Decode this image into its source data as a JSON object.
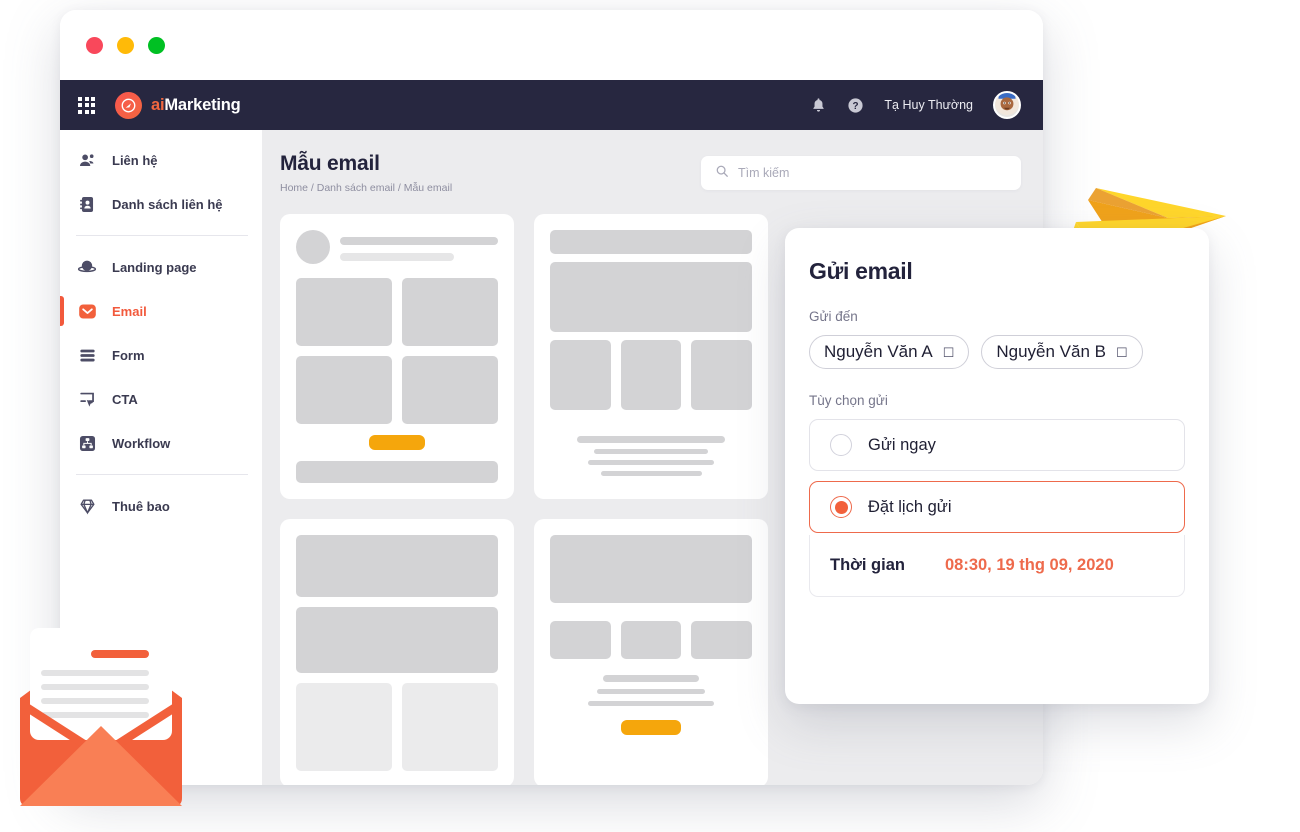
{
  "window": {
    "traffic_lights": [
      "close",
      "minimize",
      "maximize"
    ],
    "colors": {
      "close": "#F9485B",
      "minimize": "#FFBA08",
      "maximize": "#00C023"
    }
  },
  "topbar": {
    "apps_icon": "grid-apps-icon",
    "brand_prefix": "ai",
    "brand_suffix": "Marketing",
    "notifications_icon": "bell-icon",
    "help_icon": "question-circle-icon",
    "user_name": "Tạ Huy Thường",
    "avatar": "user-avatar",
    "background": "#272740"
  },
  "sidebar": {
    "items": [
      {
        "label": "Liên hệ",
        "icon": "contacts-icon",
        "active": false
      },
      {
        "label": "Danh sách liên hệ",
        "icon": "contact-book-icon",
        "active": false
      },
      {
        "label": "Landing page",
        "icon": "landing-page-icon",
        "active": false
      },
      {
        "label": "Email",
        "icon": "email-icon",
        "active": true
      },
      {
        "label": "Form",
        "icon": "form-icon",
        "active": false
      },
      {
        "label": "CTA",
        "icon": "cta-icon",
        "active": false
      },
      {
        "label": "Workflow",
        "icon": "workflow-icon",
        "active": false
      },
      {
        "label": "Thuê bao",
        "icon": "diamond-icon",
        "active": false
      }
    ],
    "active_color": "#F2593C"
  },
  "page": {
    "title": "Mẫu email",
    "breadcrumb": "Home / Danh sách email / Mẫu email",
    "search": {
      "placeholder": "Tìm kiếm",
      "value": "",
      "icon": "search-icon"
    }
  },
  "templates": {
    "cards": [
      {
        "name": "template-card-1",
        "layout": "avatar-header-2x2-grid-button"
      },
      {
        "name": "template-card-2",
        "layout": "header-hero-3col-text"
      },
      {
        "name": "template-card-3",
        "layout": "two-bars-two-tiles"
      },
      {
        "name": "template-card-4",
        "layout": "hero-3col-text-button"
      }
    ],
    "placeholder_color": "#D3D3D5",
    "accent_button_color": "#F5A60C"
  },
  "modal": {
    "title": "Gửi email",
    "recipients_label": "Gửi đến",
    "recipients": [
      {
        "name": "Nguyễn Văn A",
        "remove_icon": "remove-chip-icon"
      },
      {
        "name": "Nguyễn Văn B",
        "remove_icon": "remove-chip-icon"
      }
    ],
    "options_label": "Tùy chọn gửi",
    "options": [
      {
        "label": "Gửi ngay",
        "selected": false
      },
      {
        "label": "Đặt lịch gửi",
        "selected": true
      }
    ],
    "time_label": "Thời gian",
    "time_value": "08:30, 19 thg 09, 2020",
    "accent_color": "#EE6A4C"
  },
  "decorations": {
    "paper_plane": {
      "name": "paper-plane-illustration",
      "colors": [
        "#FFD62B",
        "#F0A21A",
        "#E8920F"
      ]
    },
    "envelope": {
      "name": "open-envelope-illustration",
      "colors": [
        "#F2603B",
        "#F97F55",
        "#FFFFFF"
      ]
    }
  }
}
